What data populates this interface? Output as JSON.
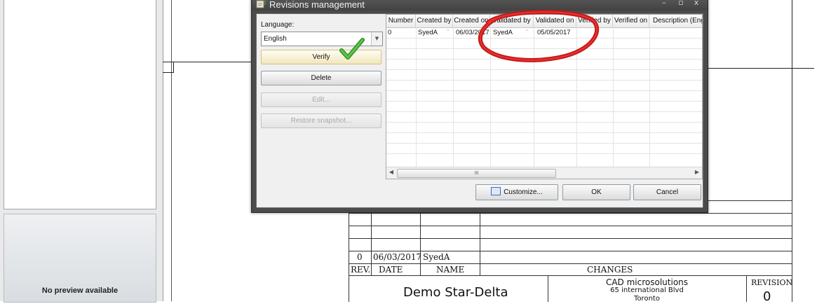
{
  "dialog": {
    "title": "Revisions management",
    "window_controls": {
      "minimize": "–",
      "maximize": "▫",
      "close": "x"
    },
    "language_label": "Language:",
    "language_value": "English",
    "buttons": {
      "verify": "Verify",
      "delete": "Delete",
      "edit": "Edit...",
      "restore": "Restore snapshot..."
    },
    "grid": {
      "columns": [
        "Number",
        "Created by",
        "Created on",
        "Validated by",
        "Validated on",
        "Verified by",
        "Verified on",
        "Description (Engli"
      ],
      "rows": [
        [
          "0",
          "SyedA",
          "06/03/2017",
          "SyedA",
          "05/05/2017",
          "",
          "",
          ""
        ]
      ],
      "scroll_thumb_grip": "III"
    },
    "footer": {
      "customize": "Customize...",
      "ok": "OK",
      "cancel": "Cancel"
    }
  },
  "preview": {
    "text": "No preview available"
  },
  "title_block": {
    "revision_row": {
      "rev": "0",
      "date": "06/03/2017",
      "name": "SyedA",
      "changes": ""
    },
    "headers": {
      "rev": "REV.",
      "date": "DATE",
      "name": "NAME",
      "changes": "CHANGES"
    },
    "project_title": "Demo Star-Delta",
    "company": {
      "name": "CAD microsolutions",
      "address1": "65 international Blvd",
      "city": "Toronto"
    },
    "revision_label": "REVISION",
    "revision_value": "0"
  },
  "colors": {
    "annotation_circle": "#d11a1a",
    "checkmark": "#3cae2b"
  }
}
